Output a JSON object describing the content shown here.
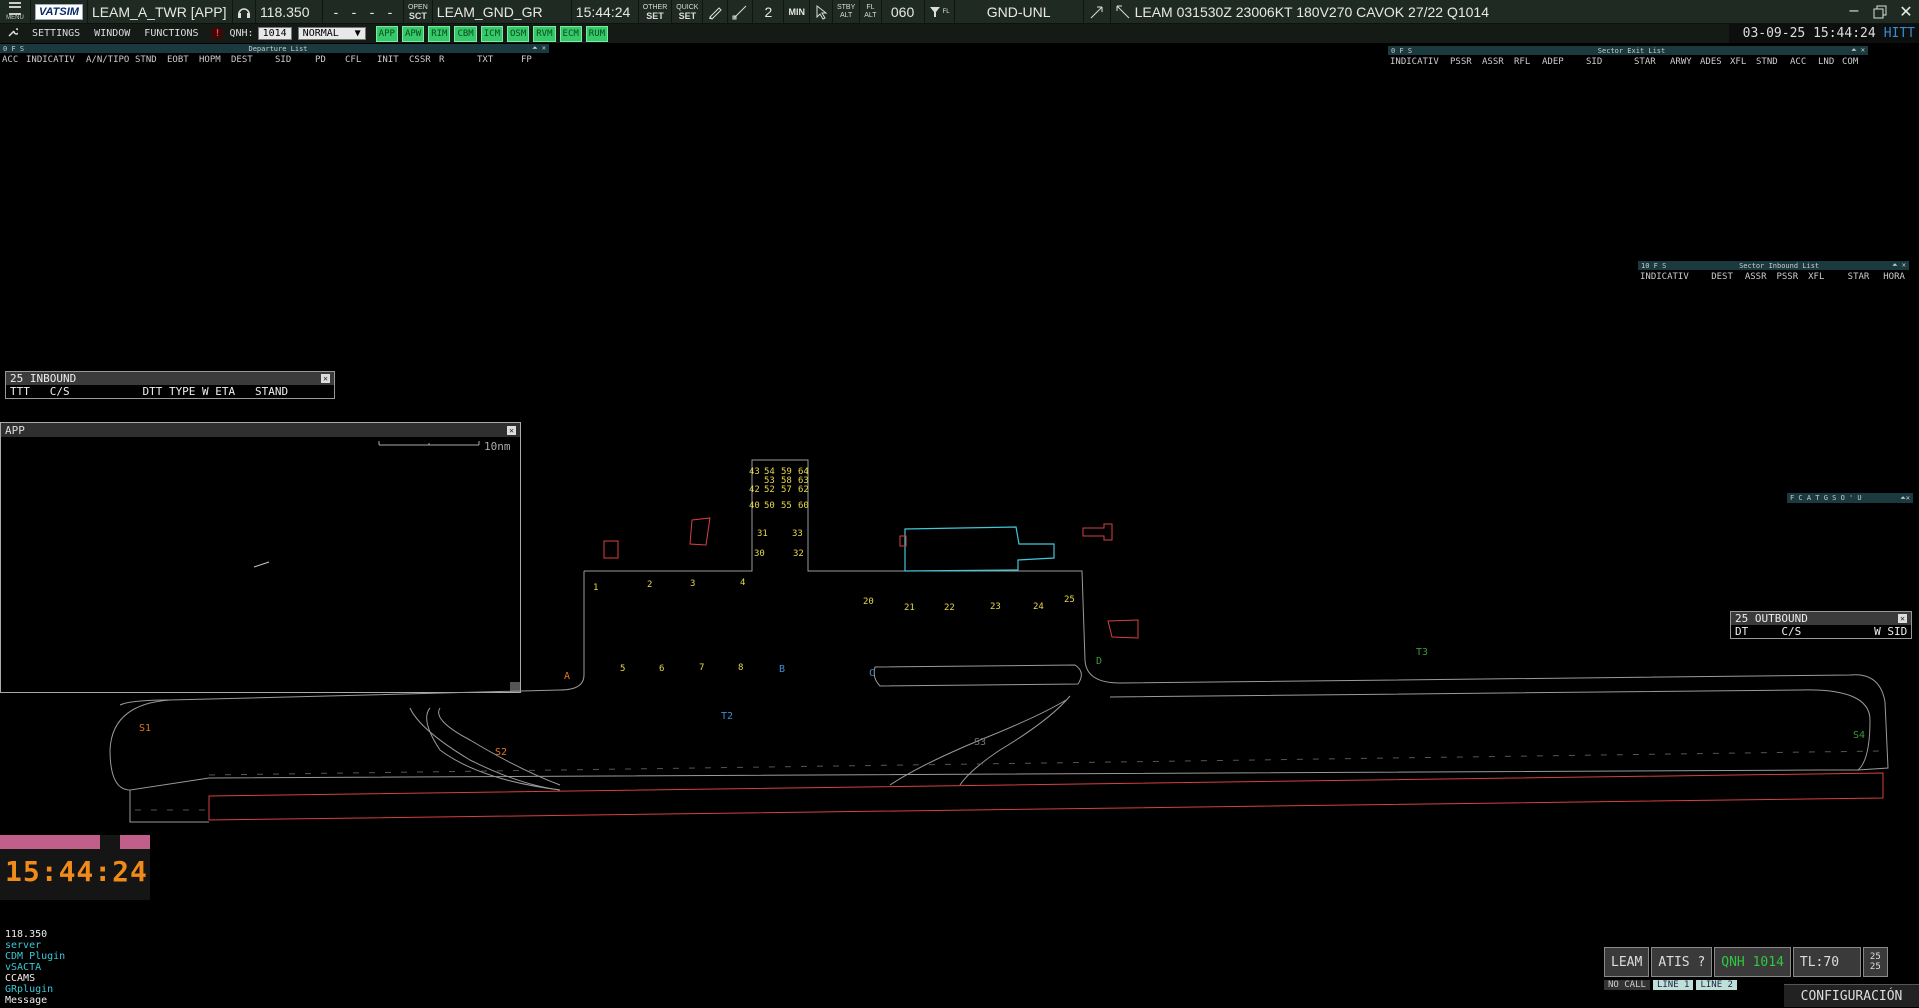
{
  "topbar": {
    "menu_label": "MENU",
    "logo": "VATSIM",
    "callsign": "LEAM_A_TWR [APP]",
    "frequency": "118.350",
    "dashes": [
      "-",
      "-",
      "-",
      "-"
    ],
    "open_sct_top": "OPEN",
    "open_sct_bottom": "SCT",
    "controller": "LEAM_GND_GR",
    "time": "15:44:24",
    "other_set_top": "OTHER",
    "other_set_bottom": "SET",
    "quick_set_top": "QUICK",
    "quick_set_bottom": "SET",
    "min_value": "2",
    "min_label": "MIN",
    "stby_alt_top": "STBY",
    "stby_alt_bottom": "ALT",
    "fl_alt_top": "FL",
    "fl_alt_bottom": "ALT",
    "alt_value": "060",
    "fl_label": "FL",
    "range": "GND-UNL",
    "metar": "LEAM 031530Z 23006KT 180V270 CAVOK 27/22 Q1014"
  },
  "toolbar": {
    "settings": "SETTINGS",
    "window": "WINDOW",
    "functions": "FUNCTIONS",
    "alert": "!",
    "qnh_label": "QNH:",
    "qnh_value": "1014",
    "mode": "NORMAL",
    "mode_arrow": "▼",
    "green_buttons": [
      "APP",
      "APW",
      "RIM",
      "CBM",
      "ICM",
      "OSM",
      "RVM",
      "ECM",
      "RUM"
    ]
  },
  "datetime": {
    "date_time": "03-09-25 15:44:24",
    "hitt": "HITT"
  },
  "departure_list": {
    "title": "Departure List",
    "flags": "0 F S",
    "columns": [
      "ACC",
      "INDICATIV",
      "A/N/TIPO",
      "STND",
      "EOBT",
      "HOPM",
      "DEST",
      "SID",
      "PD",
      "CFL",
      "INIT",
      "CSSR",
      "R",
      "TXT",
      "FP"
    ]
  },
  "sector_exit_list": {
    "title": "Sector Exit List",
    "flags": "0 F S",
    "columns": [
      "INDICATIV",
      "PSSR",
      "ASSR",
      "RFL",
      "ADEP",
      "SID",
      "STAR",
      "ARWY",
      "ADES",
      "XFL",
      "STND",
      "ACC",
      "LND",
      "COM"
    ]
  },
  "sector_inbound_list": {
    "title": "Sector Inbound List",
    "flags": "10 F S",
    "columns": [
      "INDICATIV",
      "DEST",
      "ASSR",
      "PSSR",
      "XFL",
      "STAR",
      "HORA"
    ]
  },
  "inbound_panel": {
    "title": "25 INBOUND",
    "header": "TTT   C/S           DTT TYPE W ETA   STAND"
  },
  "outbound_panel": {
    "title": "25 OUTBOUND",
    "header": "DT     C/S           W SID"
  },
  "filter_bar": "F C A T G S O ' U",
  "app_window": {
    "title": "APP",
    "scale": "10nm"
  },
  "map": {
    "stands_top": [
      "43",
      "54",
      "59",
      "64",
      "53",
      "58",
      "63",
      "42",
      "52",
      "57",
      "62",
      "40",
      "50",
      "55",
      "60"
    ],
    "stands": [
      "31",
      "33",
      "30",
      "32",
      "1",
      "2",
      "3",
      "4",
      "20",
      "21",
      "22",
      "23",
      "24",
      "25",
      "5",
      "6",
      "7",
      "8"
    ],
    "taxiways": [
      {
        "label": "A",
        "color": "#e07820"
      },
      {
        "label": "B",
        "color": "#3a8fd8"
      },
      {
        "label": "C",
        "color": "#3a8fd8"
      },
      {
        "label": "D",
        "color": "#3a9a3a"
      },
      {
        "label": "T2",
        "color": "#3a8fd8"
      },
      {
        "label": "T3",
        "color": "#3a9a3a"
      },
      {
        "label": "S1",
        "color": "#e07820"
      },
      {
        "label": "S2",
        "color": "#e07820"
      },
      {
        "label": "S3",
        "color": "#777777"
      },
      {
        "label": "S4",
        "color": "#3a9a3a"
      }
    ]
  },
  "clock": {
    "time": "15:44:24"
  },
  "messages": [
    "118.350",
    "server",
    "CDM Plugin",
    "vSACTA",
    "CCAMS",
    "GRplugin",
    "Message"
  ],
  "status_bar": {
    "airport": "LEAM",
    "atis": "ATIS ?",
    "qnh": "QNH 1014",
    "tl": "TL:70",
    "counts_top": "25",
    "counts_bottom": "25",
    "lines": [
      "NO CALL",
      "LINE 1",
      "LINE 2"
    ],
    "config": "CONFIGURACIÓN"
  },
  "colors": {
    "stand_yellow": "#e8d84a",
    "runway_red": "#d84040",
    "terminal_cyan": "#40c8d8",
    "clock_orange": "#f08a1a",
    "green_button": "#35c96a",
    "qnh_green": "#2ec840",
    "message_cyan": "#3ac8d8"
  }
}
